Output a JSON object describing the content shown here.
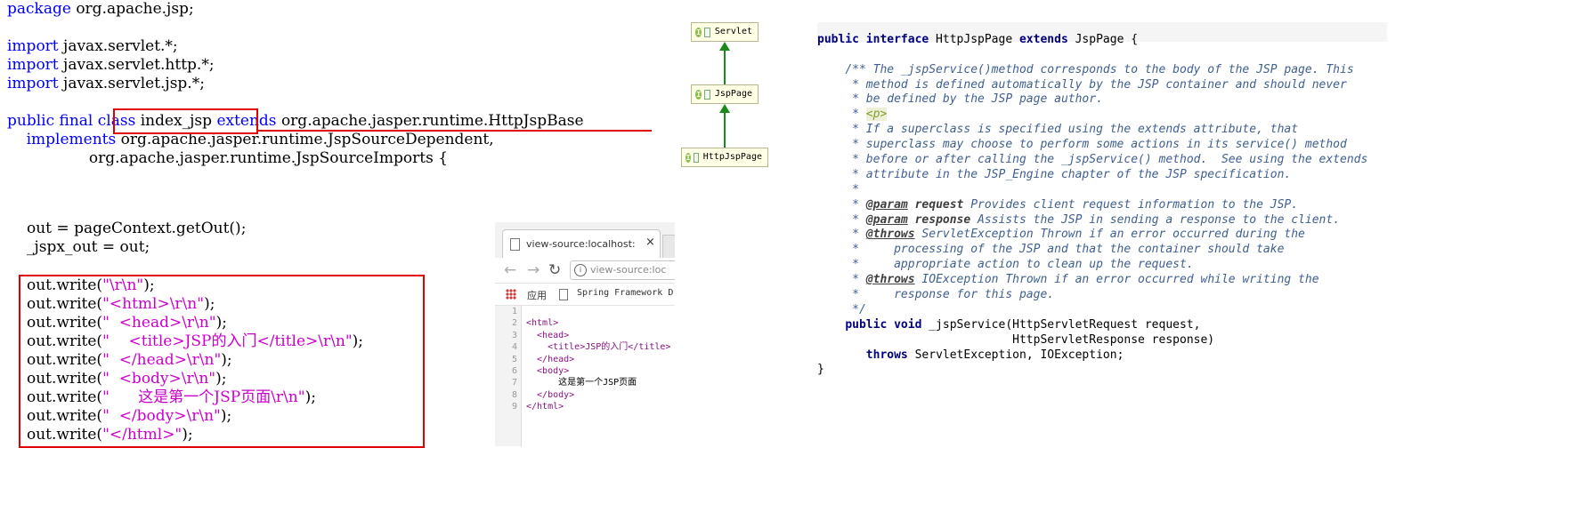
{
  "left_code": {
    "lines": [
      {
        "parts": [
          {
            "t": "package",
            "c": "kw"
          },
          {
            "t": " org.apache.jsp;",
            "c": ""
          }
        ]
      },
      {
        "parts": []
      },
      {
        "parts": [
          {
            "t": "import",
            "c": "kw"
          },
          {
            "t": " javax.servlet.*;",
            "c": ""
          }
        ]
      },
      {
        "parts": [
          {
            "t": "import",
            "c": "kw"
          },
          {
            "t": " javax.servlet.http.*;",
            "c": ""
          }
        ]
      },
      {
        "parts": [
          {
            "t": "import",
            "c": "kw"
          },
          {
            "t": " javax.servlet.jsp.*;",
            "c": ""
          }
        ]
      },
      {
        "parts": []
      },
      {
        "parts": [
          {
            "t": "public final ",
            "c": "kw"
          },
          {
            "t": "class",
            "c": "kw"
          },
          {
            "t": " index_jsp ",
            "c": ""
          },
          {
            "t": "extends",
            "c": "kw"
          },
          {
            "t": " org.apache.jasper.runtime.HttpJspBase",
            "c": ""
          }
        ]
      },
      {
        "parts": [
          {
            "t": "    implements",
            "c": "kw"
          },
          {
            "t": " org.apache.jasper.runtime.JspSourceDependent,",
            "c": ""
          }
        ]
      },
      {
        "parts": [
          {
            "t": "                 org.apache.jasper.runtime.JspSourceImports {",
            "c": ""
          }
        ]
      }
    ]
  },
  "middle_code": {
    "lines": [
      "out = pageContext.getOut();",
      "_jspx_out = out;"
    ]
  },
  "write_block": {
    "lines": [
      {
        "pre": "out.write(",
        "lit": "\"\\r\\n\"",
        "post": ");"
      },
      {
        "pre": "out.write(",
        "lit": "\"<html>\\r\\n\"",
        "post": ");"
      },
      {
        "pre": "out.write(",
        "lit": "\"  <head>\\r\\n\"",
        "post": ");"
      },
      {
        "pre": "out.write(",
        "lit": "\"    <title>JSP的入门</title>\\r\\n\"",
        "post": ");"
      },
      {
        "pre": "out.write(",
        "lit": "\"  </head>\\r\\n\"",
        "post": ");"
      },
      {
        "pre": "out.write(",
        "lit": "\"  <body>\\r\\n\"",
        "post": ");"
      },
      {
        "pre": "out.write(",
        "lit": "\"      这是第一个JSP页面\\r\\n\"",
        "post": ");"
      },
      {
        "pre": "out.write(",
        "lit": "\"  </body>\\r\\n\"",
        "post": ");"
      },
      {
        "pre": "out.write(",
        "lit": "\"</html>\"",
        "post": ");"
      }
    ]
  },
  "hierarchy": {
    "nodes": [
      "Servlet",
      "JspPage",
      "HttpJspPage"
    ],
    "icon_letter": "I"
  },
  "browser": {
    "tab_label": "view-source:localhost:",
    "tab_close": "×",
    "url": "view-source:loc",
    "bookmarks": [
      {
        "label": "应用"
      },
      {
        "label": "Spring Framework D"
      }
    ],
    "line_numbers": [
      "1",
      "2",
      "3",
      "4",
      "5",
      "6",
      "7",
      "8",
      "9"
    ],
    "source_lines": [
      "",
      "<html>",
      "  <head>",
      "    <title>JSP的入门</title>",
      "  </head>",
      "  <body>",
      "      这是第一个JSP页面",
      "  </body>",
      "</html>"
    ]
  },
  "javadoc": {
    "signature": "public interface HttpJspPage extends JspPage {",
    "comment_lines": [
      "/** The _jspService()method corresponds to the body of the JSP page. This",
      " * method is defined automatically by the JSP container and should never",
      " * be defined by the JSP page author.",
      " * <p>",
      " * If a superclass is specified using the extends attribute, that",
      " * superclass may choose to perform some actions in its service() method",
      " * before or after calling the _jspService() method.  See using the extends",
      " * attribute in the JSP_Engine chapter of the JSP specification.",
      " *",
      " * @param request Provides client request information to the JSP.",
      " * @param response Assists the JSP in sending a response to the client.",
      " * @throws ServletException Thrown if an error occurred during the",
      " *     processing of the JSP and that the container should take",
      " *     appropriate action to clean up the request.",
      " * @throws IOException Thrown if an error occurred while writing the",
      " *     response for this page.",
      " */"
    ],
    "method_lines": [
      "public void _jspService(HttpServletRequest request,",
      "                        HttpServletResponse response)",
      "   throws ServletException, IOException;"
    ],
    "closing": "}"
  }
}
